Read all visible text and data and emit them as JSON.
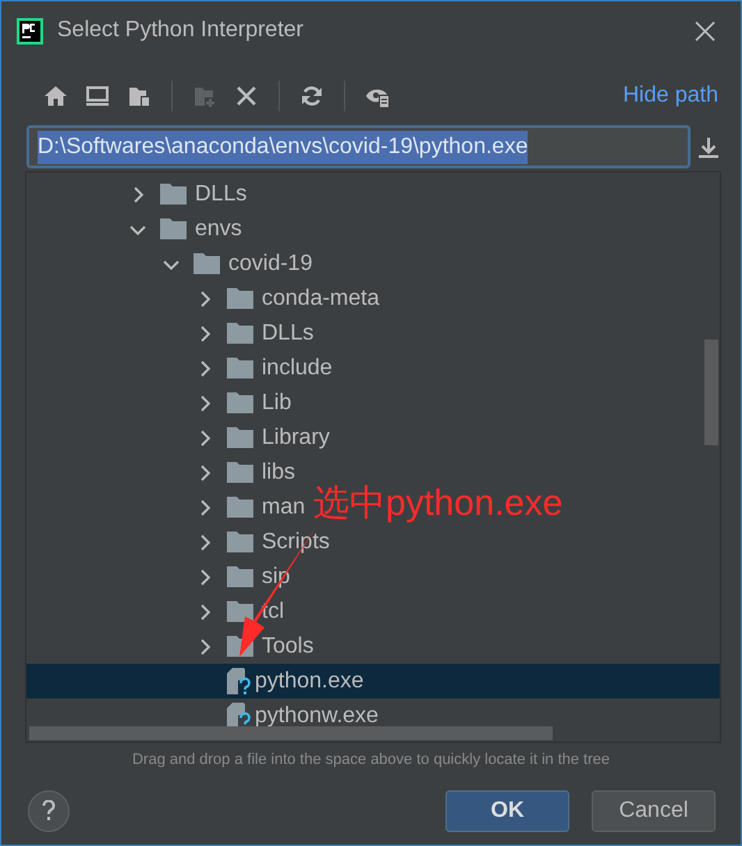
{
  "window": {
    "title": "Select Python Interpreter"
  },
  "toolbar": {
    "tools": [
      {
        "kind": "home",
        "disabled": false
      },
      {
        "kind": "desktop",
        "disabled": false
      },
      {
        "kind": "project",
        "disabled": false
      },
      {
        "kind": "new-folder",
        "disabled": true
      },
      {
        "kind": "delete",
        "disabled": false
      },
      {
        "kind": "refresh",
        "disabled": false
      },
      {
        "kind": "show-hidden",
        "disabled": false
      }
    ],
    "hide_path_link": "Hide path"
  },
  "path_field": {
    "value": "D:\\Softwares\\anaconda\\envs\\covid-19\\python.exe",
    "text_selected": true
  },
  "tree": [
    {
      "label": "DLLs",
      "kind": "folder",
      "expanded": false,
      "selected": false
    },
    {
      "label": "envs",
      "kind": "folder",
      "expanded": true,
      "selected": false,
      "children": [
        {
          "label": "covid-19",
          "kind": "folder",
          "expanded": true,
          "selected": false,
          "children": [
            {
              "label": "conda-meta",
              "kind": "folder",
              "expanded": false,
              "selected": false
            },
            {
              "label": "DLLs",
              "kind": "folder",
              "expanded": false,
              "selected": false
            },
            {
              "label": "include",
              "kind": "folder",
              "expanded": false,
              "selected": false
            },
            {
              "label": "Lib",
              "kind": "folder",
              "expanded": false,
              "selected": false
            },
            {
              "label": "Library",
              "kind": "folder",
              "expanded": false,
              "selected": false
            },
            {
              "label": "libs",
              "kind": "folder",
              "expanded": false,
              "selected": false
            },
            {
              "label": "man",
              "kind": "folder",
              "expanded": false,
              "selected": false
            },
            {
              "label": "Scripts",
              "kind": "folder",
              "expanded": false,
              "selected": false
            },
            {
              "label": "sip",
              "kind": "folder",
              "expanded": false,
              "selected": false
            },
            {
              "label": "tcl",
              "kind": "folder",
              "expanded": false,
              "selected": false
            },
            {
              "label": "Tools",
              "kind": "folder",
              "expanded": false,
              "selected": false
            },
            {
              "label": "python.exe",
              "kind": "file",
              "selected": true
            },
            {
              "label": "pythonw.exe",
              "kind": "file",
              "selected": false
            }
          ]
        }
      ]
    }
  ],
  "hint": "Drag and drop a file into the space above to quickly locate it in the tree",
  "annotation": {
    "text": "选中python.exe"
  },
  "buttons": [
    {
      "label": "OK",
      "default": true
    },
    {
      "label": "Cancel",
      "default": false
    }
  ]
}
